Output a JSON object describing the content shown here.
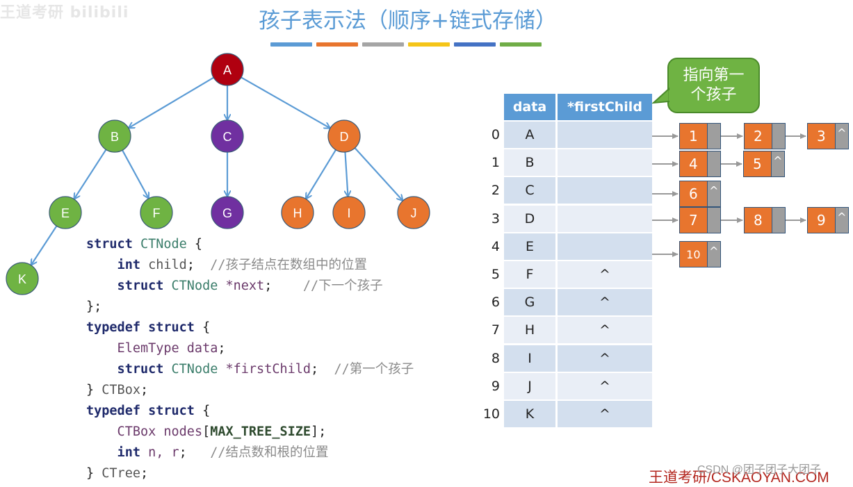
{
  "watermark": "王道考研 bilibili",
  "title": "孩子表示法（顺序+链式存储）",
  "color_bars": [
    "#5b9bd5",
    "#e8752e",
    "#a5a5a5",
    "#f5c518",
    "#4472c4",
    "#70ad47"
  ],
  "tree": {
    "nodes": [
      {
        "id": "A",
        "label": "A",
        "color": "#b00010"
      },
      {
        "id": "B",
        "label": "B",
        "color": "#6fb343"
      },
      {
        "id": "C",
        "label": "C",
        "color": "#7030a0"
      },
      {
        "id": "D",
        "label": "D",
        "color": "#e8752e"
      },
      {
        "id": "E",
        "label": "E",
        "color": "#6fb343"
      },
      {
        "id": "F",
        "label": "F",
        "color": "#6fb343"
      },
      {
        "id": "G",
        "label": "G",
        "color": "#7030a0"
      },
      {
        "id": "H",
        "label": "H",
        "color": "#e8752e"
      },
      {
        "id": "I",
        "label": "I",
        "color": "#e8752e"
      },
      {
        "id": "J",
        "label": "J",
        "color": "#e8752e"
      },
      {
        "id": "K",
        "label": "K",
        "color": "#6fb343"
      }
    ],
    "edges": [
      [
        "A",
        "B"
      ],
      [
        "A",
        "C"
      ],
      [
        "A",
        "D"
      ],
      [
        "B",
        "E"
      ],
      [
        "B",
        "F"
      ],
      [
        "C",
        "G"
      ],
      [
        "D",
        "H"
      ],
      [
        "D",
        "I"
      ],
      [
        "D",
        "J"
      ],
      [
        "E",
        "K"
      ]
    ],
    "edge_color": "#5b9bd5"
  },
  "code": {
    "lines": [
      [
        {
          "t": "struct ",
          "c": "kw"
        },
        {
          "t": "CTNode",
          "c": "ty"
        },
        {
          "t": " {",
          "c": "plain"
        }
      ],
      [
        {
          "t": "    int ",
          "c": "kw"
        },
        {
          "t": "child",
          "c": "id"
        },
        {
          "t": ";  ",
          "c": "plain"
        },
        {
          "t": "//孩子结点在数组中的位置",
          "c": "cmt"
        }
      ],
      [
        {
          "t": "    struct ",
          "c": "kw"
        },
        {
          "t": "CTNode ",
          "c": "ty"
        },
        {
          "t": "*next",
          "c": "var"
        },
        {
          "t": ";    ",
          "c": "plain"
        },
        {
          "t": "//下一个孩子",
          "c": "cmt"
        }
      ],
      [
        {
          "t": "};",
          "c": "plain"
        }
      ],
      [
        {
          "t": "typedef struct ",
          "c": "kw"
        },
        {
          "t": "{",
          "c": "plain"
        }
      ],
      [
        {
          "t": "    ElemType ",
          "c": "var"
        },
        {
          "t": "data",
          "c": "var"
        },
        {
          "t": ";",
          "c": "plain"
        }
      ],
      [
        {
          "t": "    struct ",
          "c": "kw"
        },
        {
          "t": "CTNode ",
          "c": "ty"
        },
        {
          "t": "*firstChild",
          "c": "var"
        },
        {
          "t": ";  ",
          "c": "plain"
        },
        {
          "t": "//第一个孩子",
          "c": "cmt"
        }
      ],
      [
        {
          "t": "} ",
          "c": "plain"
        },
        {
          "t": "CTBox",
          "c": "id"
        },
        {
          "t": ";",
          "c": "plain"
        }
      ],
      [
        {
          "t": "typedef struct ",
          "c": "kw"
        },
        {
          "t": "{",
          "c": "plain"
        }
      ],
      [
        {
          "t": "    CTBox ",
          "c": "var"
        },
        {
          "t": "nodes",
          "c": "var"
        },
        {
          "t": "[",
          "c": "plain"
        },
        {
          "t": "MAX_TREE_SIZE",
          "c": "mac"
        },
        {
          "t": "];",
          "c": "plain"
        }
      ],
      [
        {
          "t": "    int ",
          "c": "kw"
        },
        {
          "t": "n, r",
          "c": "var"
        },
        {
          "t": ";   ",
          "c": "plain"
        },
        {
          "t": "//结点数和根的位置",
          "c": "cmt"
        }
      ],
      [
        {
          "t": "} ",
          "c": "plain"
        },
        {
          "t": "CTree",
          "c": "id"
        },
        {
          "t": ";",
          "c": "plain"
        }
      ]
    ]
  },
  "table": {
    "headers": [
      "data",
      "*firstChild"
    ],
    "rows": [
      {
        "index": "0",
        "data": "A",
        "firstChild": ""
      },
      {
        "index": "1",
        "data": "B",
        "firstChild": ""
      },
      {
        "index": "2",
        "data": "C",
        "firstChild": ""
      },
      {
        "index": "3",
        "data": "D",
        "firstChild": ""
      },
      {
        "index": "4",
        "data": "E",
        "firstChild": ""
      },
      {
        "index": "5",
        "data": "F",
        "firstChild": "^"
      },
      {
        "index": "6",
        "data": "G",
        "firstChild": "^"
      },
      {
        "index": "7",
        "data": "H",
        "firstChild": "^"
      },
      {
        "index": "8",
        "data": "I",
        "firstChild": "^"
      },
      {
        "index": "9",
        "data": "J",
        "firstChild": "^"
      },
      {
        "index": "10",
        "data": "K",
        "firstChild": "^"
      }
    ],
    "header_color": "#5b9bd5",
    "row_colors": [
      "#d3dfee",
      "#e9eef6"
    ]
  },
  "callout": {
    "line1": "指向第一",
    "line2": "个孩子"
  },
  "child_lists": [
    {
      "row": 0,
      "children": [
        "1",
        "2",
        "3"
      ]
    },
    {
      "row": 1,
      "children": [
        "4",
        "5"
      ]
    },
    {
      "row": 2,
      "children": [
        "6"
      ]
    },
    {
      "row": 3,
      "children": [
        "7",
        "8",
        "9"
      ]
    },
    {
      "row": 4,
      "children": [
        "10"
      ]
    }
  ],
  "null_symbol": "^",
  "footer": {
    "brand": "王道考研/CSKAOYAN.COM",
    "csdn": "CSDN @团子团子大团子"
  }
}
